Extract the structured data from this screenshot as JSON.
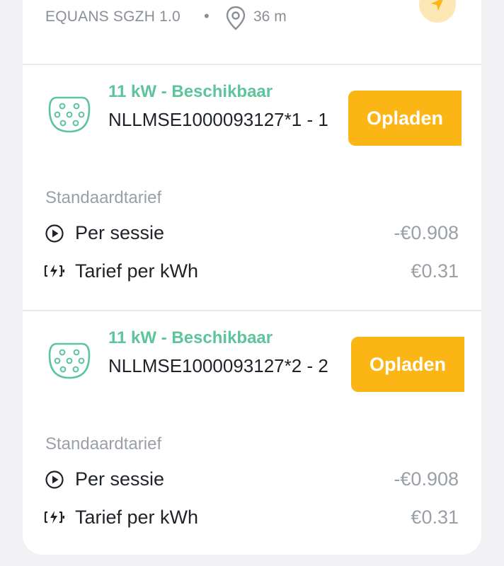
{
  "header": {
    "operator": "EQUANS SGZH 1.0",
    "separator": "•",
    "distance": "36 m"
  },
  "connectors": [
    {
      "status": "11 kW - Beschikbaar",
      "evse_id": "NLLMSE1000093127*1 - 1",
      "button": "Opladen",
      "tariff_title": "Standaardtarief",
      "rows": [
        {
          "label": "Per sessie",
          "value": "-€0.908",
          "icon": "play-circle-icon"
        },
        {
          "label": "Tarief per kWh",
          "value": "€0.31",
          "icon": "battery-charging-icon"
        }
      ]
    },
    {
      "status": "11 kW - Beschikbaar",
      "evse_id": "NLLMSE1000093127*2 - 2",
      "button": "Opladen",
      "tariff_title": "Standaardtarief",
      "rows": [
        {
          "label": "Per sessie",
          "value": "-€0.908",
          "icon": "play-circle-icon"
        },
        {
          "label": "Tarief per kWh",
          "value": "€0.31",
          "icon": "battery-charging-icon"
        }
      ]
    }
  ],
  "colors": {
    "accent": "#fbb515",
    "available": "#5dc49b",
    "muted": "#9aa0a6",
    "text": "#1f2328"
  }
}
